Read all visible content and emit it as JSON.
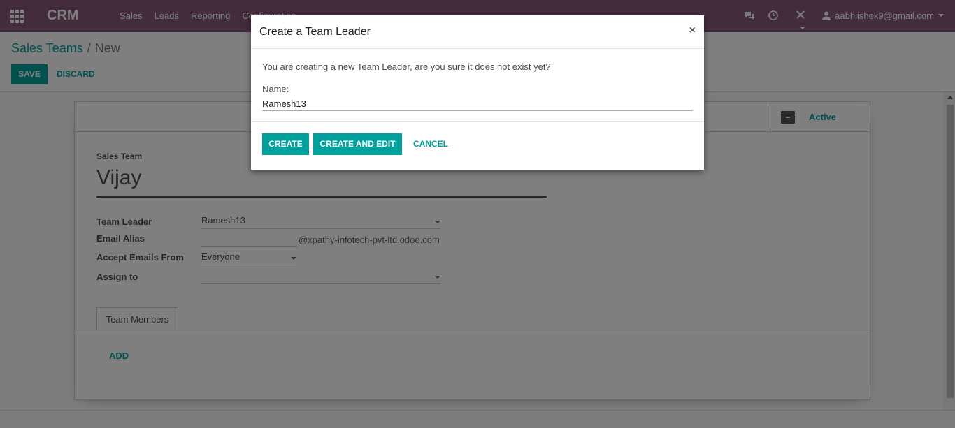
{
  "navbar": {
    "brand": "CRM",
    "menu": [
      "Sales",
      "Leads",
      "Reporting",
      "Configuration"
    ],
    "user": "aabhiishek9@gmail.com",
    "bg_color": "#875a7b"
  },
  "breadcrumb": {
    "parent": "Sales Teams",
    "separator": "/",
    "current": "New"
  },
  "actions": {
    "save": "SAVE",
    "discard": "DISCARD"
  },
  "form": {
    "active_label": "Active",
    "team_label": "Sales Team",
    "team_name": "Vijay",
    "fields": {
      "team_leader_label": "Team Leader",
      "team_leader_value": "Ramesh13",
      "email_alias_label": "Email Alias",
      "email_alias_suffix": "@xpathy-infotech-pvt-ltd.odoo.com",
      "accept_emails_label": "Accept Emails From",
      "accept_emails_value": "Everyone",
      "assign_to_label": "Assign to",
      "assign_to_value": ""
    },
    "tab": "Team Members",
    "add_link": "ADD"
  },
  "modal": {
    "title": "Create a Team Leader",
    "close": "×",
    "message": "You are creating a new Team Leader, are you sure it does not exist yet?",
    "name_label": "Name:",
    "name_value": "Ramesh13",
    "buttons": {
      "create": "CREATE",
      "create_and_edit": "CREATE AND EDIT",
      "cancel": "CANCEL"
    }
  },
  "accent_color": "#00a09d"
}
